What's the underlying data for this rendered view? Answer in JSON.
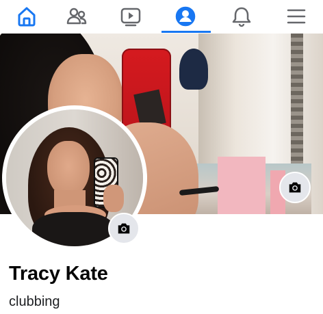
{
  "nav": {
    "items": [
      {
        "name": "home",
        "icon": "home-icon",
        "active": false
      },
      {
        "name": "friends",
        "icon": "friends-icon",
        "active": false
      },
      {
        "name": "watch",
        "icon": "video-icon",
        "active": false
      },
      {
        "name": "profile",
        "icon": "profile-icon",
        "active": true
      },
      {
        "name": "notifications",
        "icon": "bell-icon",
        "active": false
      },
      {
        "name": "menu",
        "icon": "hamburger-menu-icon",
        "active": false
      }
    ],
    "active_color": "#1877f2",
    "inactive_color": "#65676b"
  },
  "cover": {
    "image": "cover-photo",
    "camera_icon": "camera-icon"
  },
  "avatar": {
    "image": "profile-picture",
    "camera_icon": "camera-icon"
  },
  "profile": {
    "name": "Tracy Kate",
    "bio": "clubbing"
  }
}
